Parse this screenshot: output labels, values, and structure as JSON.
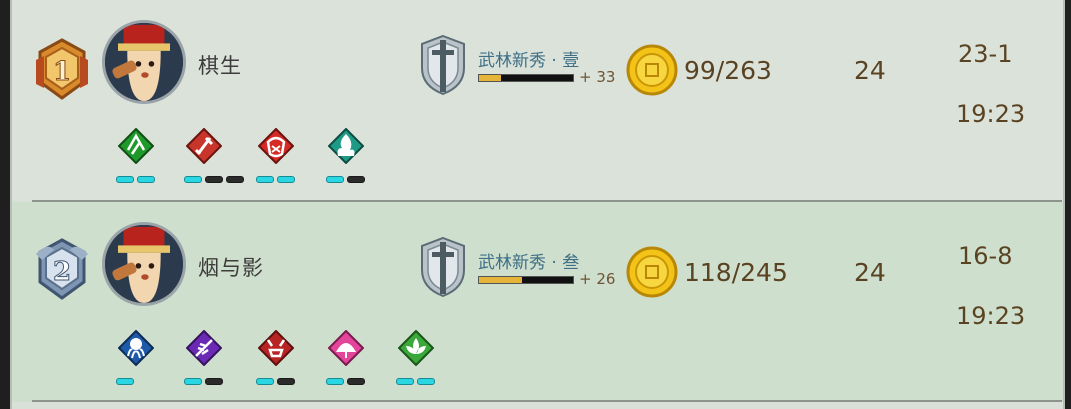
{
  "players": [
    {
      "rank": "1",
      "name": "棋生",
      "tier_label": "武林新秀 · 壹",
      "tier_progress": 0.23,
      "tier_delta": "+ 33",
      "gold": "99/263",
      "level": "24",
      "record": "23-1",
      "time": "19:23",
      "heroes": [
        {
          "icon": "green-wind-hero-icon",
          "color": "#1f9a2a",
          "stars": 2,
          "slots": 2
        },
        {
          "icon": "red-sword-hero-icon",
          "color": "#c8362b",
          "stars": 1,
          "slots": 3
        },
        {
          "icon": "red-mask-hero-icon",
          "color": "#d62a24",
          "stars": 2,
          "slots": 2
        },
        {
          "icon": "teal-flame-hero-icon",
          "color": "#1f9a86",
          "stars": 1,
          "slots": 2
        }
      ]
    },
    {
      "rank": "2",
      "name": "烟与影",
      "tier_label": "武林新秀 · 叁",
      "tier_progress": 0.46,
      "tier_delta": "+ 26",
      "gold": "118/245",
      "level": "24",
      "record": "16-8",
      "time": "19:23",
      "heroes": [
        {
          "icon": "blue-octopus-hero-icon",
          "color": "#1d5aa8",
          "stars": 1,
          "slots": 1
        },
        {
          "icon": "purple-feather-hero-icon",
          "color": "#6b2ab6",
          "stars": 1,
          "slots": 2
        },
        {
          "icon": "red-demon-hero-icon",
          "color": "#b82424",
          "stars": 1,
          "slots": 2
        },
        {
          "icon": "pink-fan-hero-icon",
          "color": "#e2459a",
          "stars": 1,
          "slots": 2
        },
        {
          "icon": "green-lotus-hero-icon",
          "color": "#3aa83a",
          "stars": 2,
          "slots": 2
        }
      ]
    }
  ]
}
